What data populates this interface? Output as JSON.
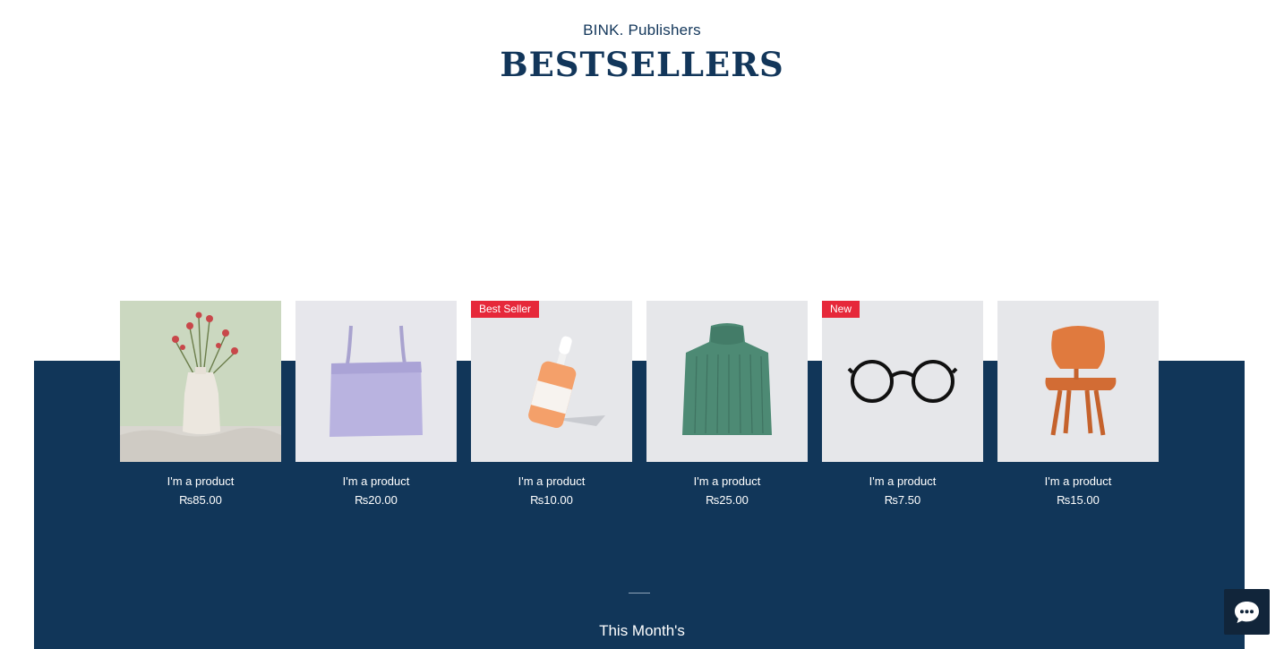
{
  "header": {
    "brand": "BINK. Publishers",
    "title": "BESTSELLERS"
  },
  "products": [
    {
      "name": "I'm a product",
      "price": "₨85.00",
      "ribbon": "",
      "image": "flower-vase"
    },
    {
      "name": "I'm a product",
      "price": "₨20.00",
      "ribbon": "",
      "image": "tote-bag"
    },
    {
      "name": "I'm a product",
      "price": "₨10.00",
      "ribbon": "Best Seller",
      "image": "serum-bottle"
    },
    {
      "name": "I'm a product",
      "price": "₨25.00",
      "ribbon": "",
      "image": "green-sweater"
    },
    {
      "name": "I'm a product",
      "price": "₨7.50",
      "ribbon": "New",
      "image": "eyeglasses"
    },
    {
      "name": "I'm a product",
      "price": "₨15.00",
      "ribbon": "",
      "image": "wooden-chair"
    }
  ],
  "section": {
    "heading": "This Month's"
  },
  "chat": {
    "icon": "chat-bubble-icon"
  },
  "colors": {
    "navy": "#113659",
    "ribbon": "#e6283a",
    "heading": "#12365a"
  }
}
